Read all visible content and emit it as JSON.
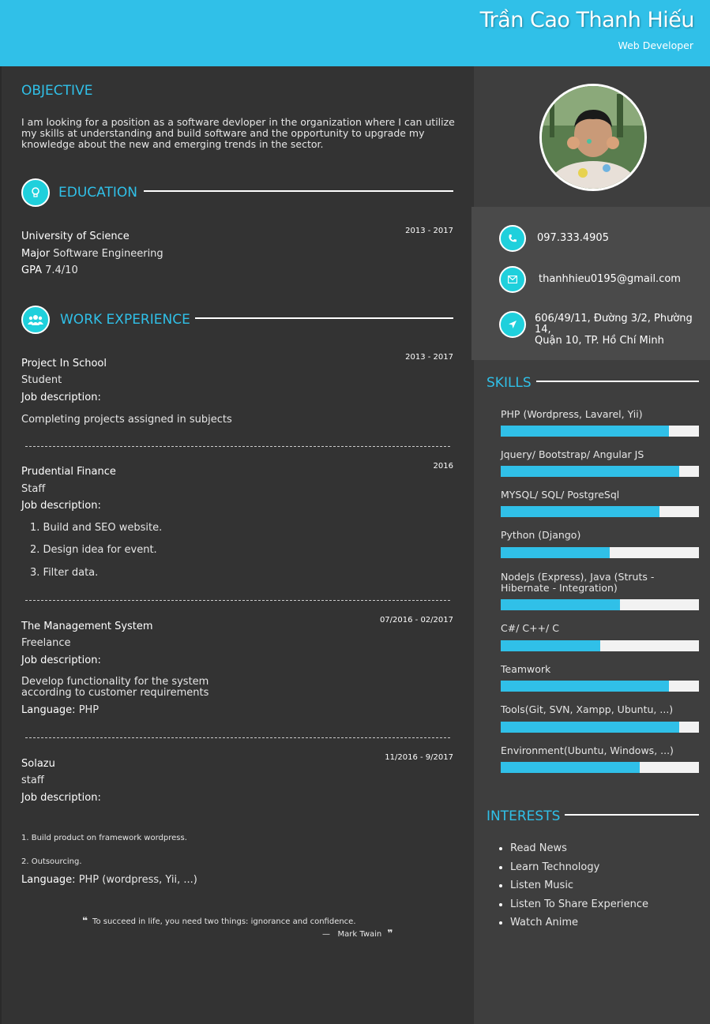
{
  "header": {
    "name": "Trần Cao Thanh Hiếu",
    "role": "Web Developer"
  },
  "objective": {
    "title": "OBJECTIVE",
    "lines": [
      "I am looking for a position as a software devloper in the organization where I can utilize",
      "my skills at understanding and build software and the opportunity to upgrade my",
      "knowledge about the new and emerging trends in the sector."
    ]
  },
  "education": {
    "title": "EDUCATION",
    "school": "University of Science",
    "date": "2013 - 2017",
    "major_label": "Major",
    "major": "Software Engineering",
    "gpa_label": "GPA",
    "gpa": "7.4/10"
  },
  "work": {
    "title": "WORK EXPERIENCE",
    "job_desc_label": "Job description:",
    "language_label": "Language:",
    "items": [
      {
        "company": "Project In School",
        "role": "Student",
        "date": "2013 - 2017",
        "desc": "Completing projects assigned in subjects"
      },
      {
        "company": "Prudential Finance",
        "role": "Staff",
        "date": "2016",
        "tasks": [
          "1. Build and SEO website.",
          "2. Design idea for event.",
          "3. Filter data."
        ]
      },
      {
        "company": "The Management System",
        "role": "Freelance",
        "date": "07/2016 - 02/2017",
        "desc_lines": [
          "Develop functionality for the system",
          "according to customer requirements"
        ],
        "language": "PHP"
      },
      {
        "company": "Solazu",
        "role": "staff",
        "date": "11/2016 - 9/2017",
        "tasks": [
          "1. Build product on framework wordpress.",
          "2. Outsourcing."
        ],
        "language": "PHP (wordpress, Yii, ...)"
      }
    ]
  },
  "quote": {
    "text": "To succeed in life, you need two things: ignorance and confidence.",
    "author": "Mark Twain",
    "dash": "—"
  },
  "contact": {
    "phone": "097.333.4905",
    "email": "thanhhieu0195@gmail.com",
    "address_lines": [
      "606/49/11, Đường 3/2, Phường 14,",
      "Quận 10, TP. Hồ Chí Minh"
    ]
  },
  "skills": {
    "title": "SKILLS",
    "items": [
      {
        "label": "PHP (Wordpress, Lavarel, Yii)",
        "level": 0.85
      },
      {
        "label": "Jquery/ Bootstrap/ Angular JS",
        "level": 0.9
      },
      {
        "label": "MYSQL/ SQL/ PostgreSql",
        "level": 0.8
      },
      {
        "label": "Python (Django)",
        "level": 0.55
      },
      {
        "label": "NodeJs (Express), Java (Struts - Hibernate - Integration)",
        "level": 0.6
      },
      {
        "label": "C#/ C++/ C",
        "level": 0.5
      },
      {
        "label": "Teamwork",
        "level": 0.85
      },
      {
        "label": "Tools(Git, SVN, Xampp, Ubuntu, ...)",
        "level": 0.9
      },
      {
        "label": "Environment(Ubuntu, Windows, ...)",
        "level": 0.7
      }
    ]
  },
  "interests": {
    "title": "INTERESTS",
    "items": [
      "Read News",
      "Learn Technology",
      "Listen Music",
      "Listen To Share Experience",
      "Watch Anime"
    ]
  },
  "colors": {
    "accent": "#30c0e8",
    "icon_bg": "#1fd0dc",
    "background": "#333333",
    "sidebar": "#3e3e3e"
  },
  "icons": {
    "education": "lightbulb-icon",
    "work": "users-icon",
    "phone": "phone-icon",
    "email": "envelope-icon",
    "address": "location-arrow-icon"
  }
}
